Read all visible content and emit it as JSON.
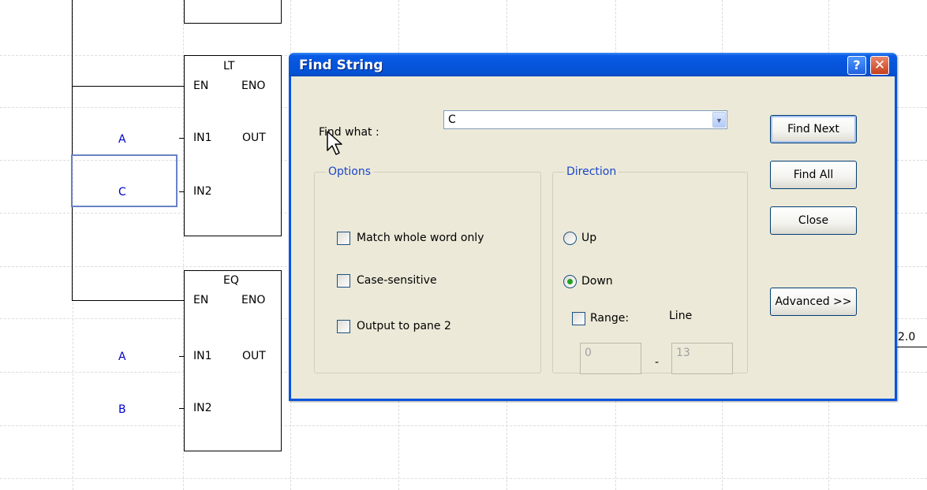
{
  "ladder": {
    "block_lt": {
      "name": "LT",
      "en": "EN",
      "eno": "ENO",
      "in1": "IN1",
      "in2": "IN2",
      "out": "OUT"
    },
    "block_eq": {
      "name": "EQ",
      "en": "EN",
      "eno": "ENO",
      "in1": "IN1",
      "in2": "IN2",
      "out": "OUT"
    },
    "lt_in1_var": "A",
    "lt_in2_var": "C",
    "eq_in1_var": "A",
    "eq_in2_var": "B",
    "partial_label": "2.0"
  },
  "dialog": {
    "title": "Find String",
    "help_icon": "question-mark-icon",
    "close_icon": "close-x-icon",
    "find_what_label": "Find what :",
    "find_what_value": "C",
    "options": {
      "title": "Options",
      "match_whole_word": "Match whole word only",
      "case_sensitive": "Case-sensitive",
      "output_pane2": "Output to pane 2"
    },
    "direction": {
      "title": "Direction",
      "up": "Up",
      "down": "Down",
      "selected": "Down",
      "range_label": "Range:",
      "line_label": "Line",
      "range_from": "0",
      "range_sep": "-",
      "range_to": "13"
    },
    "buttons": {
      "find_next": "Find Next",
      "find_all": "Find All",
      "close": "Close",
      "advanced": "Advanced >>"
    }
  },
  "colors": {
    "titlebar": "#0655dc",
    "dialog_face": "#ece9d8",
    "variable_text": "#0000cc",
    "group_title": "#1b45c8"
  }
}
